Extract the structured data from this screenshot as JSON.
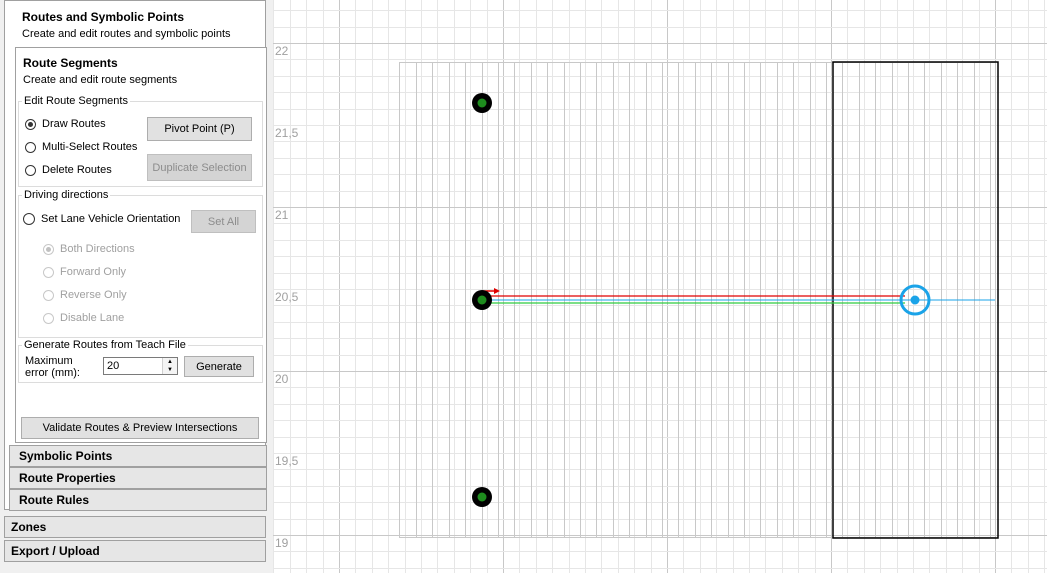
{
  "panel": {
    "title": "Routes and Symbolic Points",
    "subtitle": "Create and edit routes and symbolic points",
    "route_segments": {
      "title": "Route Segments",
      "subtitle": "Create and edit route segments",
      "edit_group": {
        "title": "Edit Route Segments",
        "draw_routes": "Draw Routes",
        "multi_select": "Multi-Select Routes",
        "delete_routes": "Delete Routes",
        "selected": "Draw Routes",
        "pivot_button": "Pivot Point (P)",
        "duplicate_button": "Duplicate Selection"
      },
      "driving_group": {
        "title": "Driving directions",
        "set_orientation": "Set Lane Vehicle Orientation",
        "set_all_button": "Set All",
        "both": "Both Directions",
        "forward": "Forward Only",
        "reverse": "Reverse Only",
        "disable": "Disable Lane"
      },
      "generate_group": {
        "title": "Generate Routes from Teach File",
        "max_error_label_1": "Maximum",
        "max_error_label_2": "error (mm):",
        "max_error_value": "20",
        "generate_button": "Generate"
      },
      "validate_button": "Validate Routes & Preview Intersections"
    },
    "sections": [
      "Symbolic Points",
      "Route Properties",
      "Route Rules"
    ]
  },
  "outer_sections": [
    "Zones",
    "Export / Upload"
  ],
  "canvas": {
    "y_ticks": [
      "22",
      "21,5",
      "21",
      "20,5",
      "20",
      "19,5",
      "19"
    ],
    "colors": {
      "grid_minor": "#e6e6e6",
      "grid_major": "#c8c8c8",
      "block_lines": "#c8c8c8",
      "selection": "#000000",
      "route_red": "#e00000",
      "route_green": "#2ecc40",
      "route_blue": "#1aa3e8",
      "point_outer": "#000000",
      "point_inner": "#1e8c1e"
    }
  }
}
